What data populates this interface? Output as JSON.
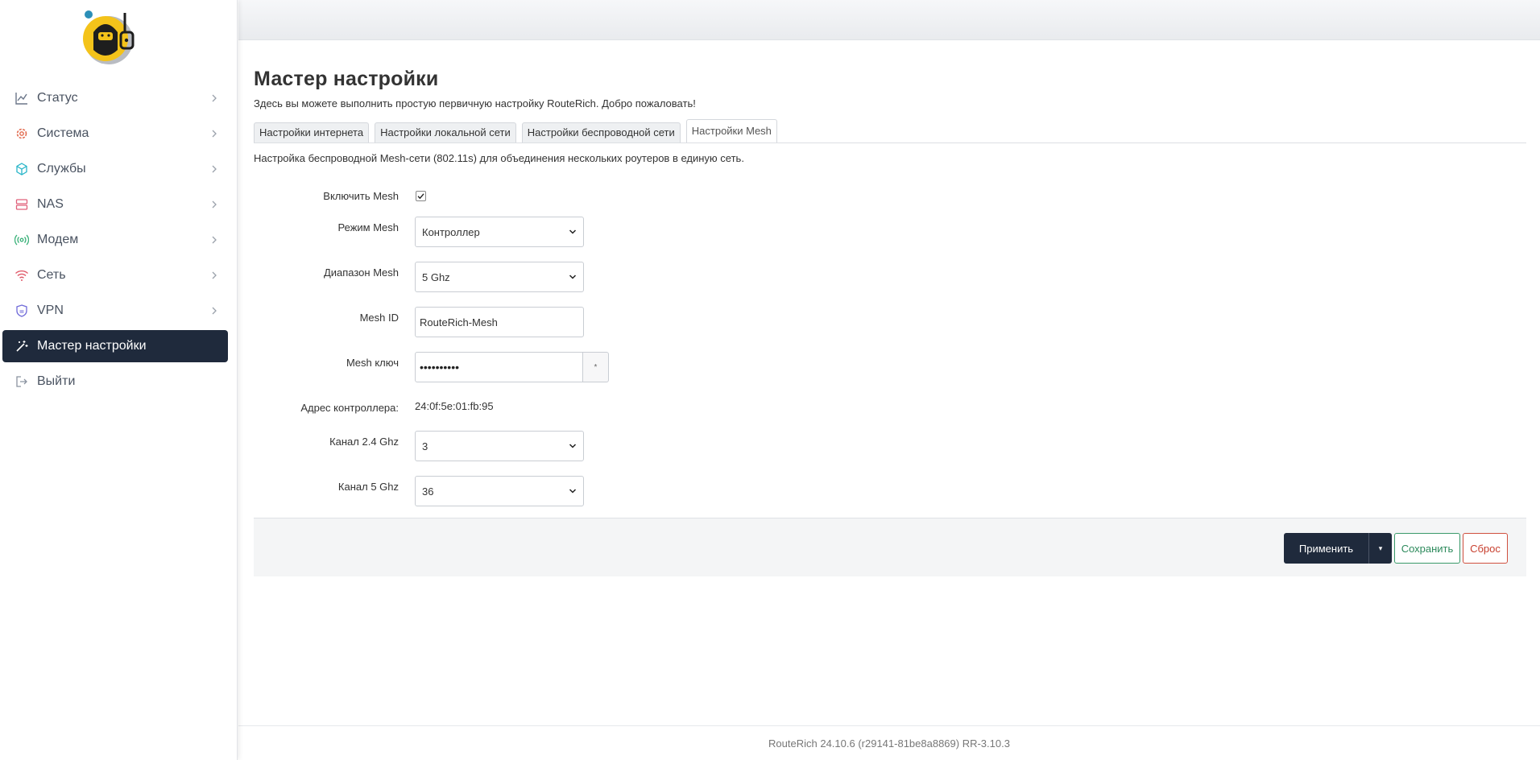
{
  "colors": {
    "accent": "#1f2a3c",
    "save": "#2d8a5c",
    "reset": "#c8402f",
    "icon_status": "#6b7689",
    "icon_system": "#e26b4f",
    "icon_services": "#27b5c8",
    "icon_nas": "#e0607a",
    "icon_modem": "#3bb27a",
    "icon_net": "#e05a6a",
    "icon_vpn": "#6f6ad8"
  },
  "sidebar": {
    "items": [
      {
        "label": "Статус",
        "icon": "chart-line-icon"
      },
      {
        "label": "Система",
        "icon": "gear-icon"
      },
      {
        "label": "Службы",
        "icon": "cube-icon"
      },
      {
        "label": "NAS",
        "icon": "server-icon"
      },
      {
        "label": "Модем",
        "icon": "broadcast-icon"
      },
      {
        "label": "Сеть",
        "icon": "wifi-icon"
      },
      {
        "label": "VPN",
        "icon": "shield-icon"
      },
      {
        "label": "Мастер настройки",
        "icon": "wand-icon",
        "active": true
      },
      {
        "label": "Выйти",
        "icon": "logout-icon"
      }
    ]
  },
  "page": {
    "title": "Мастер настройки",
    "description": "Здесь вы можете выполнить простую первичную настройку RouteRich. Добро пожаловать!"
  },
  "tabs": [
    {
      "label": "Настройки интернета"
    },
    {
      "label": "Настройки локальной сети"
    },
    {
      "label": "Настройки беспроводной сети"
    },
    {
      "label": "Настройки Mesh",
      "active": true
    }
  ],
  "section": {
    "description": "Настройка беспроводной Mesh-сети (802.11s) для объединения нескольких роутеров в единую сеть."
  },
  "form": {
    "enable_mesh": {
      "label": "Включить Mesh",
      "checked": true
    },
    "mesh_mode": {
      "label": "Режим Mesh",
      "value": "Контроллер"
    },
    "mesh_band": {
      "label": "Диапазон Mesh",
      "value": "5 Ghz"
    },
    "mesh_id": {
      "label": "Mesh ID",
      "value": "RouteRich-Mesh"
    },
    "mesh_key": {
      "label": "Mesh ключ",
      "value": "••••••••••",
      "reveal": "*"
    },
    "controller_addr": {
      "label": "Адрес контроллера:",
      "value": "24:0f:5e:01:fb:95"
    },
    "channel_24": {
      "label": "Канал 2.4 Ghz",
      "value": "3"
    },
    "channel_5": {
      "label": "Канал 5 Ghz",
      "value": "36"
    }
  },
  "actions": {
    "apply": "Применить",
    "apply_split": "▾",
    "save": "Сохранить",
    "reset": "Сброс"
  },
  "footer": {
    "text": "RouteRich 24.10.6 (r29141-81be8a8869) RR-3.10.3"
  }
}
